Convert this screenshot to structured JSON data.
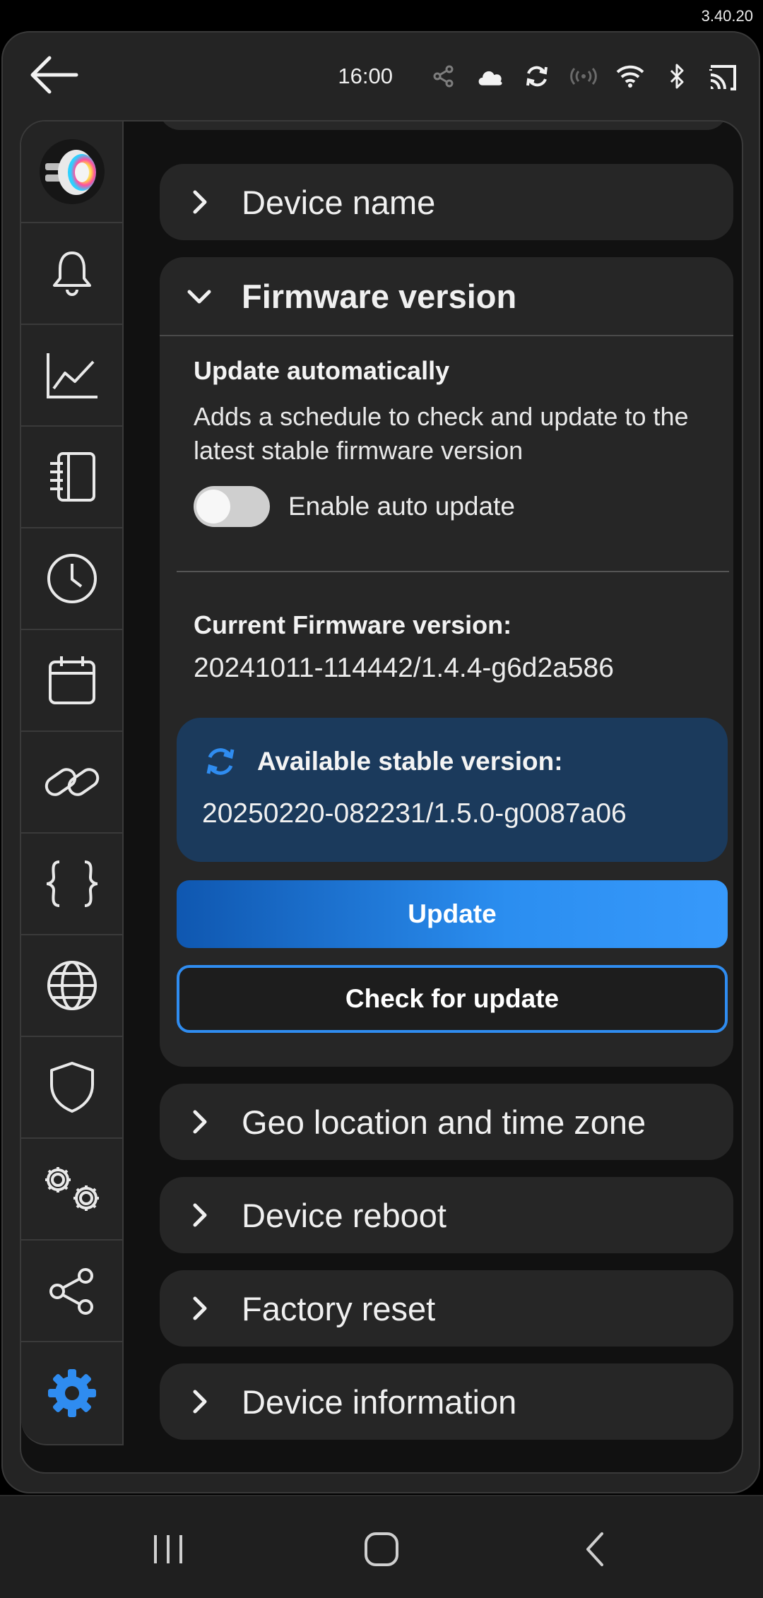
{
  "version_tag": "3.40.20",
  "status": {
    "clock": "16:00"
  },
  "icons": {
    "back": "arrow-left-icon",
    "status": [
      "share-icon",
      "cloud-icon",
      "sync-icon",
      "broadcast-icon",
      "wifi-icon",
      "bluetooth-icon",
      "cast-icon"
    ]
  },
  "sidebar": {
    "items": [
      {
        "name": "device-avatar",
        "icon": "smart-plug-icon"
      },
      {
        "name": "notifications",
        "icon": "bell-icon"
      },
      {
        "name": "statistics",
        "icon": "chart-line-icon"
      },
      {
        "name": "logs",
        "icon": "notebook-icon"
      },
      {
        "name": "timers",
        "icon": "clock-icon"
      },
      {
        "name": "schedules",
        "icon": "calendar-icon"
      },
      {
        "name": "actions",
        "icon": "link-icon"
      },
      {
        "name": "scripts",
        "icon": "braces-icon"
      },
      {
        "name": "network",
        "icon": "globe-icon"
      },
      {
        "name": "security",
        "icon": "shield-icon"
      },
      {
        "name": "advanced",
        "icon": "gears-icon"
      },
      {
        "name": "sharing",
        "icon": "share-icon"
      },
      {
        "name": "settings",
        "icon": "gear-icon",
        "active": true
      }
    ]
  },
  "sections": {
    "device_name": "Device name",
    "firmware": {
      "title": "Firmware version",
      "auto_title": "Update automatically",
      "auto_desc": "Adds a schedule to check and update to the latest stable firmware version",
      "toggle_label": "Enable auto update",
      "toggle_on": false,
      "current_title": "Current Firmware version:",
      "current_value": "20241011-114442/1.4.4-g6d2a586",
      "available_title": "Available stable version:",
      "available_value": "20250220-082231/1.5.0-g0087a06",
      "update_button": "Update",
      "check_button": "Check for update"
    },
    "geo": "Geo location and time zone",
    "reboot": "Device reboot",
    "factory_reset": "Factory reset",
    "device_info": "Device information"
  },
  "colors": {
    "accent": "#2f8cf0",
    "available_bg": "#1b3a5c",
    "card_bg": "#262626"
  }
}
